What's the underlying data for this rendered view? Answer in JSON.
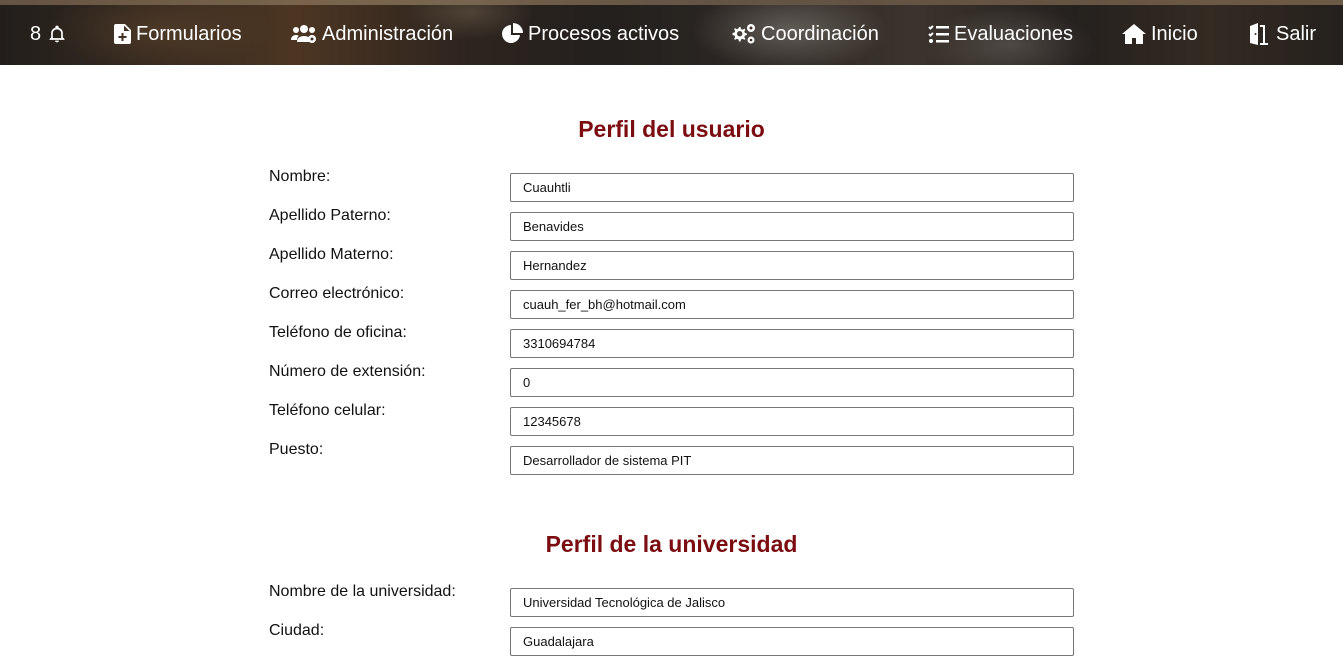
{
  "nav": {
    "notifications_count": "8",
    "items": [
      {
        "label": "Formularios",
        "icon": "file-plus-icon"
      },
      {
        "label": "Administración",
        "icon": "users-cog-icon"
      },
      {
        "label": "Procesos activos",
        "icon": "pie-chart-icon"
      },
      {
        "label": "Coordinación",
        "icon": "cogs-icon"
      },
      {
        "label": "Evaluaciones",
        "icon": "tasks-list-icon"
      },
      {
        "label": "Inicio",
        "icon": "home-icon"
      },
      {
        "label": "Salir",
        "icon": "door-exit-icon"
      }
    ]
  },
  "user_profile": {
    "title": "Perfil del usuario",
    "fields": [
      {
        "label": "Nombre:",
        "value": "Cuauhtli"
      },
      {
        "label": "Apellido Paterno:",
        "value": "Benavides"
      },
      {
        "label": "Apellido Materno:",
        "value": "Hernandez"
      },
      {
        "label": "Correo electrónico:",
        "value": "cuauh_fer_bh@hotmail.com"
      },
      {
        "label": "Teléfono de oficina:",
        "value": "3310694784"
      },
      {
        "label": "Número de extensión:",
        "value": "0"
      },
      {
        "label": "Teléfono celular:",
        "value": "12345678"
      },
      {
        "label": "Puesto:",
        "value": "Desarrollador de sistema PIT"
      }
    ]
  },
  "university_profile": {
    "title": "Perfil de la universidad",
    "fields": [
      {
        "label": "Nombre de la universidad:",
        "value": "Universidad Tecnológica de Jalisco"
      },
      {
        "label": "Ciudad:",
        "value": "Guadalajara"
      }
    ]
  },
  "colors": {
    "title": "#7b0c10",
    "nav_text": "#ffffff"
  }
}
